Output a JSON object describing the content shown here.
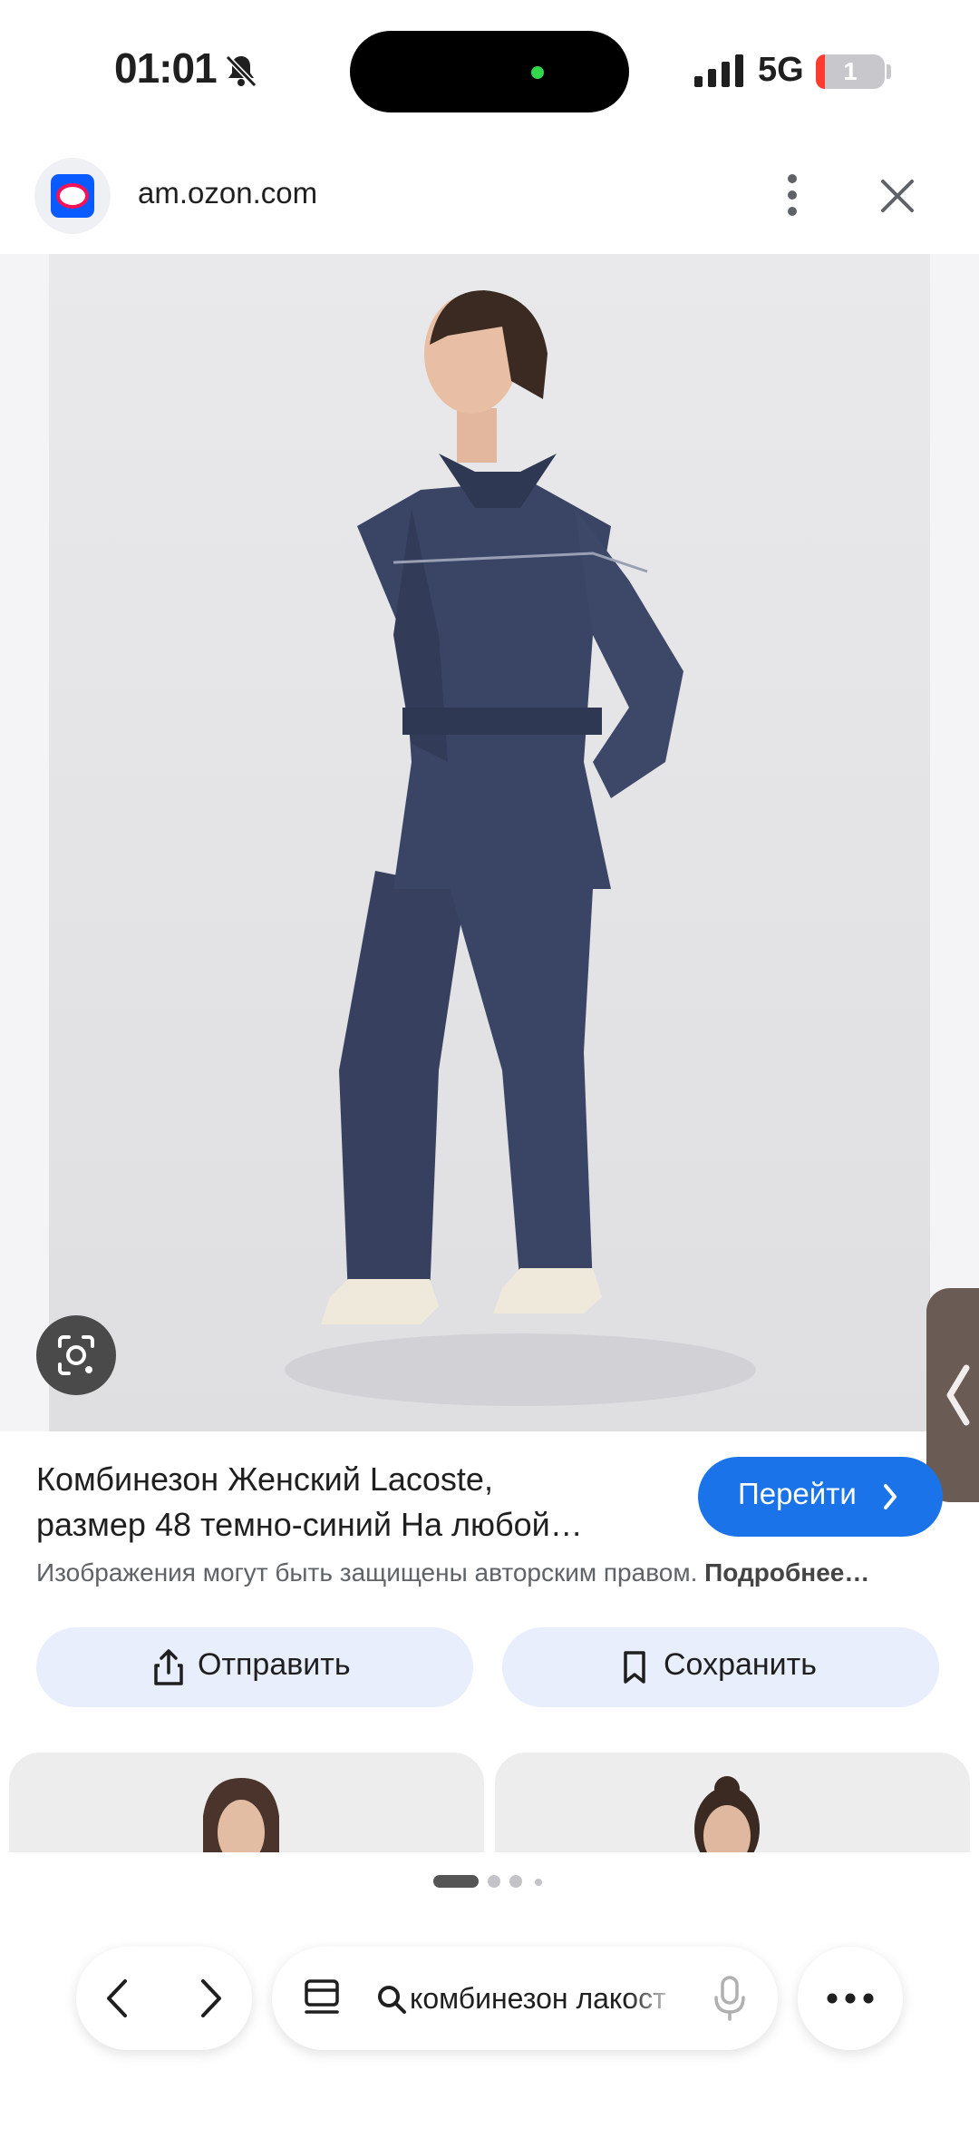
{
  "status_bar": {
    "time": "01:01",
    "network": "5G",
    "battery": "1",
    "icons": [
      "bell-slash-icon",
      "signal-bars-icon",
      "battery-icon"
    ]
  },
  "site_header": {
    "domain": "am.ozon.com",
    "favicon": "ozon-logo",
    "icons": [
      "more-vertical-icon",
      "close-icon"
    ]
  },
  "image_viewer": {
    "image": "product-photo",
    "lens_icon": "lens-search-icon",
    "side_handle_icon": "chevron-left-icon"
  },
  "caption": {
    "title_line1": "Комбинезон Женский Lacoste,",
    "title_line2": "размер 48 темно-синий На любой…",
    "go_label": "Перейти",
    "copyright_text": "Изображения могут быть защищены авторским правом.",
    "more_link": "Подробнее…"
  },
  "actions": {
    "share_label": "Отправить",
    "save_label": "Сохранить"
  },
  "bottom_bar": {
    "search_query": "комбинезон лакост",
    "pager_active_index": 0,
    "pager_count": 4
  },
  "colors": {
    "accent": "#1a73e8",
    "pill_bg": "#e8eefb",
    "jumpsuit": "#3a4566",
    "backdrop": "#e6e6e8"
  }
}
